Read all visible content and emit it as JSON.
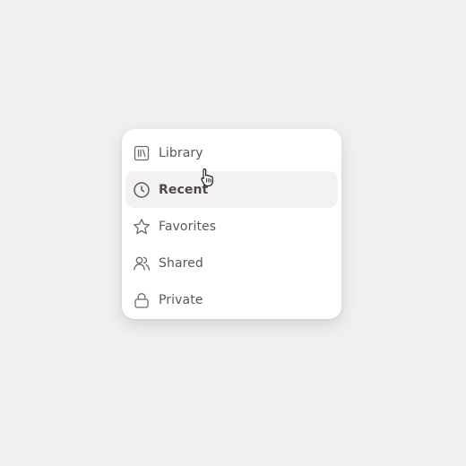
{
  "menu": {
    "items": [
      {
        "label": "Library",
        "icon": "library-icon",
        "active": false
      },
      {
        "label": "Recent",
        "icon": "clock-icon",
        "active": true
      },
      {
        "label": "Favorites",
        "icon": "star-icon",
        "active": false
      },
      {
        "label": "Shared",
        "icon": "users-icon",
        "active": false
      },
      {
        "label": "Private",
        "icon": "lock-icon",
        "active": false
      }
    ]
  },
  "colors": {
    "background": "#f1efef",
    "panel": "#ffffff",
    "active_row": "#f3f1f1",
    "text": "#5b5757",
    "icon": "#6e6a6a"
  }
}
